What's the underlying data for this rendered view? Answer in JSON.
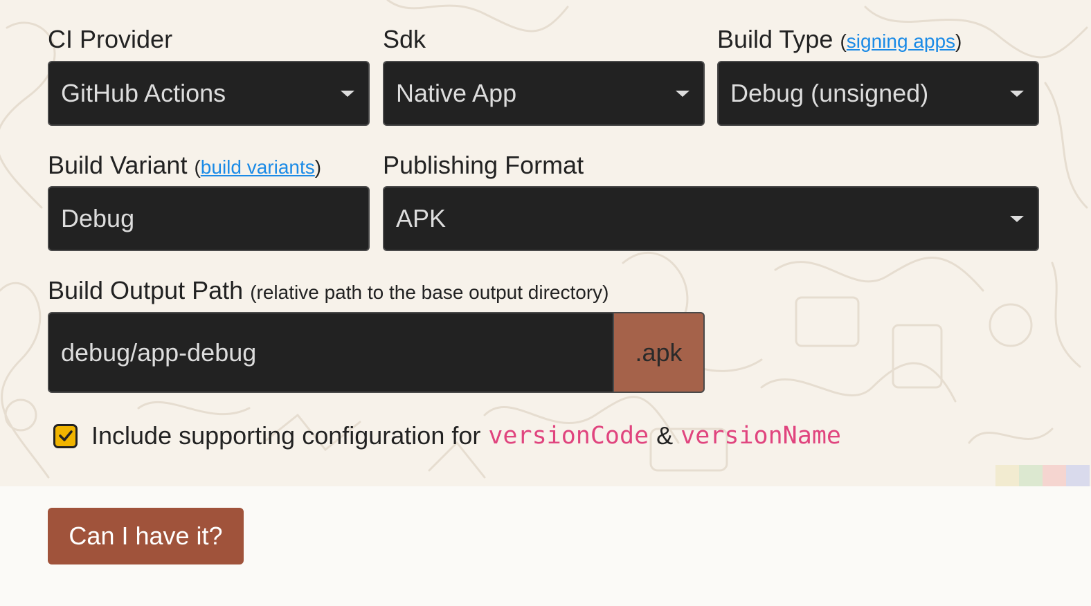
{
  "colors": {
    "accent": "#a0533b",
    "addon": "#a5624a",
    "field_bg": "#222222",
    "link": "#1a8ae6",
    "code": "#e0447e",
    "checkbox": "#f0b400"
  },
  "ci_provider": {
    "label": "CI Provider",
    "value": "GitHub Actions"
  },
  "sdk": {
    "label": "Sdk",
    "value": "Native App"
  },
  "build_type": {
    "label": "Build Type",
    "link_text": "signing apps",
    "paren_open": "(",
    "paren_close": ")",
    "value": "Debug (unsigned)"
  },
  "build_variant": {
    "label": "Build Variant",
    "link_text": "build variants",
    "paren_open": "(",
    "paren_close": ")",
    "value": "Debug"
  },
  "publishing_format": {
    "label": "Publishing Format",
    "value": "APK"
  },
  "build_output_path": {
    "label": "Build Output Path",
    "hint": "(relative path to the base output directory)",
    "value": "debug/app-debug",
    "suffix": ".apk"
  },
  "version_config": {
    "checked": true,
    "text_before": "Include supporting configuration for",
    "code1": "versionCode",
    "ampersand": "&",
    "code2": "versionName"
  },
  "submit": {
    "label": "Can I have it?"
  }
}
